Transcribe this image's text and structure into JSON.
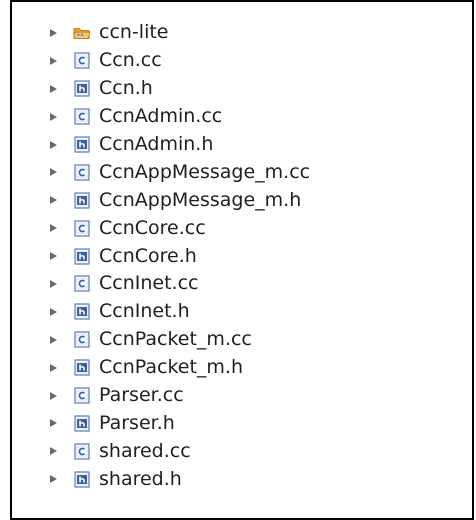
{
  "project_explorer": {
    "items": [
      {
        "label": "ccn-lite",
        "icon": "folder-icon",
        "type": "folder"
      },
      {
        "label": "Ccn.cc",
        "icon": "c-source-file-icon",
        "type": "cc"
      },
      {
        "label": "Ccn.h",
        "icon": "header-file-icon",
        "type": "h"
      },
      {
        "label": "CcnAdmin.cc",
        "icon": "c-source-file-icon",
        "type": "cc"
      },
      {
        "label": "CcnAdmin.h",
        "icon": "header-file-icon",
        "type": "h"
      },
      {
        "label": "CcnAppMessage_m.cc",
        "icon": "c-source-file-icon",
        "type": "cc"
      },
      {
        "label": "CcnAppMessage_m.h",
        "icon": "header-file-icon",
        "type": "h"
      },
      {
        "label": "CcnCore.cc",
        "icon": "c-source-file-icon",
        "type": "cc"
      },
      {
        "label": "CcnCore.h",
        "icon": "header-file-icon",
        "type": "h"
      },
      {
        "label": "CcnInet.cc",
        "icon": "c-source-file-icon",
        "type": "cc"
      },
      {
        "label": "CcnInet.h",
        "icon": "header-file-icon",
        "type": "h"
      },
      {
        "label": "CcnPacket_m.cc",
        "icon": "c-source-file-icon",
        "type": "cc"
      },
      {
        "label": "CcnPacket_m.h",
        "icon": "header-file-icon",
        "type": "h"
      },
      {
        "label": "Parser.cc",
        "icon": "c-source-file-icon",
        "type": "cc"
      },
      {
        "label": "Parser.h",
        "icon": "header-file-icon",
        "type": "h"
      },
      {
        "label": "shared.cc",
        "icon": "c-source-file-icon",
        "type": "cc"
      },
      {
        "label": "shared.h",
        "icon": "header-file-icon",
        "type": "h"
      }
    ]
  },
  "colors": {
    "arrow": "#6b6b6b",
    "folder": "#f0a030",
    "c_icon_border": "#5a7fb5",
    "c_letter": "#3366aa",
    "h_icon_fill": "#3b5fa0",
    "text": "#1f1f1f"
  }
}
